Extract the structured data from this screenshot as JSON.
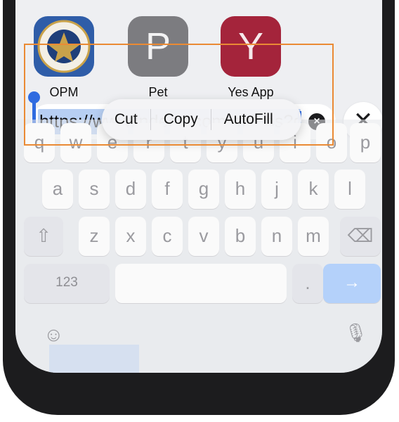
{
  "apps": [
    {
      "label": "OPM",
      "bg": "#2f5da8"
    },
    {
      "label": "Pet",
      "bg": "#7c7c80",
      "letter": "P"
    },
    {
      "label": "Yes App",
      "bg": "#a4243b",
      "letter": "Y"
    }
  ],
  "edit_menu": [
    "Cut",
    "Copy",
    "AutoFill"
  ],
  "url": {
    "value": "https://www.indeed.com/m/jobs?q"
  },
  "clear_glyph": "×",
  "close_glyph": "✕",
  "keyboard": {
    "row1": [
      "q",
      "w",
      "e",
      "r",
      "t",
      "y",
      "u",
      "i",
      "o",
      "p"
    ],
    "row2": [
      "a",
      "s",
      "d",
      "f",
      "g",
      "h",
      "j",
      "k",
      "l"
    ],
    "row3": [
      "z",
      "x",
      "c",
      "v",
      "b",
      "n",
      "m"
    ],
    "shift_glyph": "⇧",
    "delete_glyph": "⌫",
    "numbers_label": "123",
    "period_label": ".",
    "go_glyph": "→",
    "emoji_glyph": "☺",
    "mic_glyph": "🎙"
  },
  "colors": {
    "accent": "#2f6be0",
    "selection": "#b7cff3",
    "highlight": "#ea8a34"
  }
}
